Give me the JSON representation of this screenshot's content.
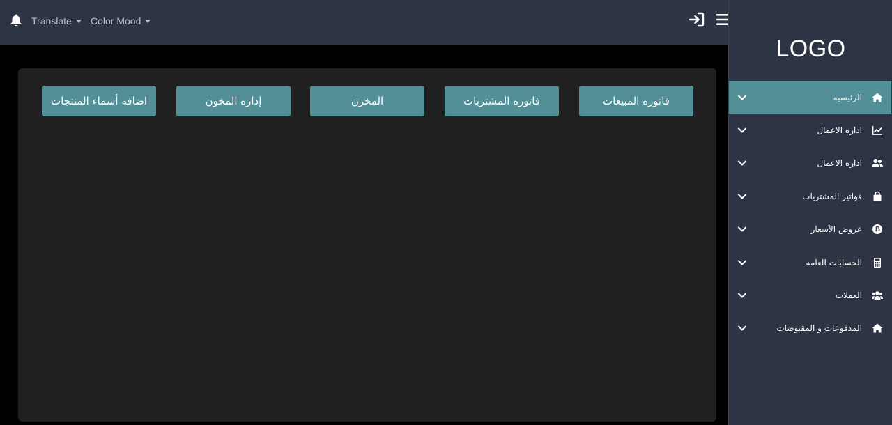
{
  "topbar": {
    "bell_icon": "bell-icon",
    "translate_label": "Translate",
    "color_mood_label": "Color Mood",
    "login_icon": "sign-in-icon",
    "menu_icon": "hamburger-menu-icon"
  },
  "sidebar": {
    "logo": "LOGO",
    "items": [
      {
        "label": "الرئيسيه",
        "icon": "home-icon",
        "active": true
      },
      {
        "label": "اداره الاعمال",
        "icon": "chart-line-icon",
        "active": false
      },
      {
        "label": "اداره الاعمال",
        "icon": "users-icon",
        "active": false
      },
      {
        "label": "فواتير المشتريات",
        "icon": "shopping-bag-icon",
        "active": false
      },
      {
        "label": "عروض الأسعار",
        "icon": "bitcoin-icon",
        "active": false
      },
      {
        "label": "الحسابات العامه",
        "icon": "calculator-icon",
        "active": false
      },
      {
        "label": "العملات",
        "icon": "user-group-icon",
        "active": false
      },
      {
        "label": "المدفوعات و المقبوضات",
        "icon": "home-icon",
        "active": false
      }
    ]
  },
  "main": {
    "buttons": [
      "فاتوره المبيعات",
      "فاتوره المشتريات",
      "المخزن",
      "إداره المخون",
      "اضافه أسماء المنتجات"
    ]
  },
  "colors": {
    "topbar_bg": "#2d3444",
    "accent": "#528f97",
    "panel_bg": "#202020",
    "page_bg": "#000000"
  }
}
